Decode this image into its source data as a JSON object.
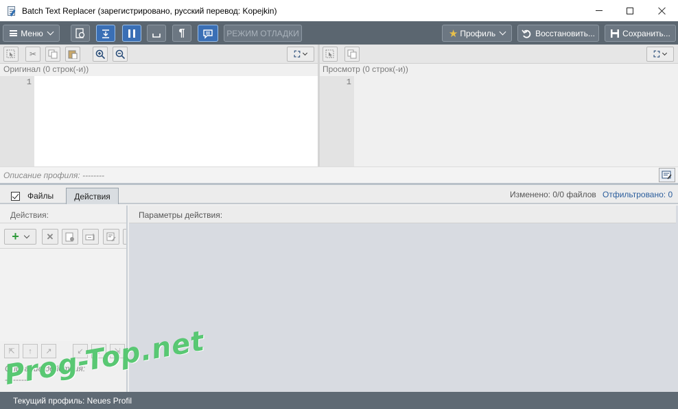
{
  "window": {
    "title": "Batch Text Replacer (зарегистрировано,  русский перевод: Kopejkin)"
  },
  "toolbar": {
    "menu_label": "Меню",
    "debug_label": "РЕЖИМ ОТЛАДКИ",
    "profile_label": "Профиль",
    "restore_label": "Восстановить...",
    "save_label": "Сохранить...",
    "pilcrow": "¶"
  },
  "editors": {
    "original_label": "Оригинал (0 строк(-и))",
    "preview_label": "Просмотр (0 строк(-и))",
    "original_line": "1",
    "preview_line": "1"
  },
  "profile_description": "Описание профиля:  --------",
  "tabs": {
    "files": "Файлы",
    "actions": "Действия"
  },
  "stats": {
    "changed": "Изменено: 0/0 файлов",
    "filtered": "Отфильтровано: 0"
  },
  "actions_panel": {
    "header": "Действия:",
    "description_label": "Описание действия:",
    "description_value": "--------"
  },
  "params_panel": {
    "header": "Параметры действия:"
  },
  "status": {
    "text": "Текущий профиль: Neues Profil"
  },
  "watermark": "Prog-Top.net",
  "colors": {
    "toolbar_bg": "#5b6670",
    "active_btn": "#3a6fb5",
    "status_bg": "#5f6a74",
    "link": "#2a5d9c"
  }
}
